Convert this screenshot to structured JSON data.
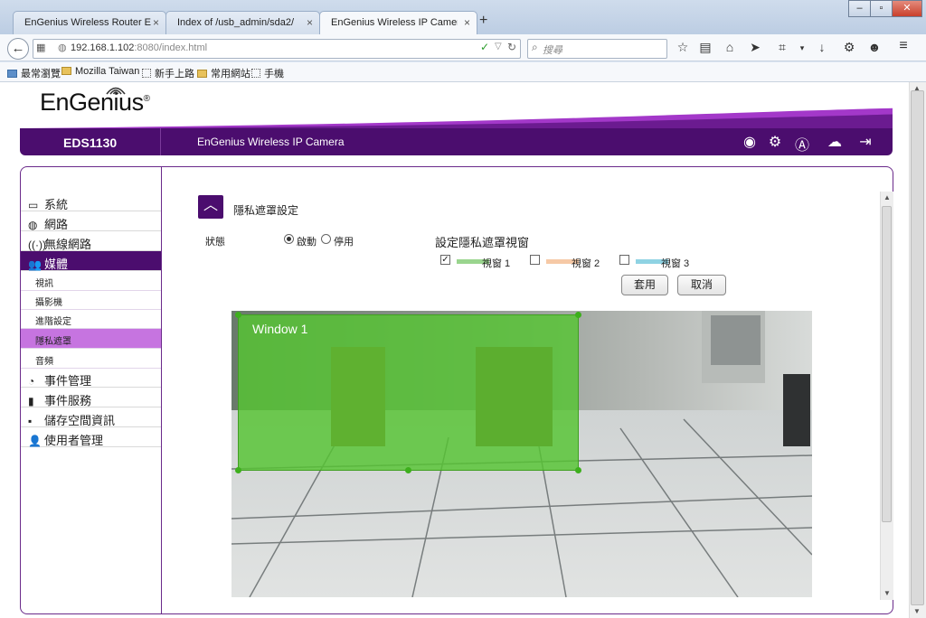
{
  "browser": {
    "tabs": [
      {
        "label": "EnGenius Wireless Router ES...",
        "active": false
      },
      {
        "label": "Index of /usb_admin/sda2/",
        "active": false
      },
      {
        "label": "EnGenius Wireless IP Camera",
        "active": true
      }
    ],
    "new_tab": "+",
    "url_host": "192.168.1.102",
    "url_port_path": ":8080/index.html",
    "search_placeholder": "搜尋",
    "bookmarks": [
      "最常瀏覽",
      "Mozilla Taiwan",
      "新手上路",
      "常用網站",
      "手機"
    ]
  },
  "header": {
    "logo": "EnGenius",
    "model": "EDS1130",
    "title": "EnGenius Wireless IP Camera"
  },
  "sidebar": {
    "items": [
      {
        "label": "系統",
        "icon": "monitor-icon"
      },
      {
        "label": "網路",
        "icon": "globe-icon"
      },
      {
        "label": "無線網路",
        "icon": "wireless-icon"
      },
      {
        "label": "媒體",
        "icon": "users-icon",
        "selected": true
      },
      {
        "label": "事件管理",
        "icon": "event-icon"
      },
      {
        "label": "事件服務",
        "icon": "server-icon"
      },
      {
        "label": "儲存空間資訊",
        "icon": "sdcard-icon"
      },
      {
        "label": "使用者管理",
        "icon": "user-icon"
      }
    ],
    "subitems": [
      {
        "label": "視訊"
      },
      {
        "label": "攝影機"
      },
      {
        "label": "進階設定"
      },
      {
        "label": "隱私遮罩",
        "selected": true
      },
      {
        "label": "音頻"
      }
    ]
  },
  "content": {
    "section_title": "隱私遮罩設定",
    "status_label": "狀態",
    "enable_label": "啟動",
    "disable_label": "停用",
    "mask_header": "設定隱私遮罩視窗",
    "windows": [
      {
        "label": "視窗 1",
        "checked": true,
        "color": "#9ad58e"
      },
      {
        "label": "視窗 2",
        "checked": false,
        "color": "#f6c9a6"
      },
      {
        "label": "視窗 3",
        "checked": false,
        "color": "#8fd3e3"
      }
    ],
    "apply_label": "套用",
    "cancel_label": "取消",
    "mask_window_label": "Window 1"
  },
  "colors": {
    "brand": "#4b0d6e",
    "submenu_selected": "#c674e0",
    "mask": "#56c432"
  }
}
